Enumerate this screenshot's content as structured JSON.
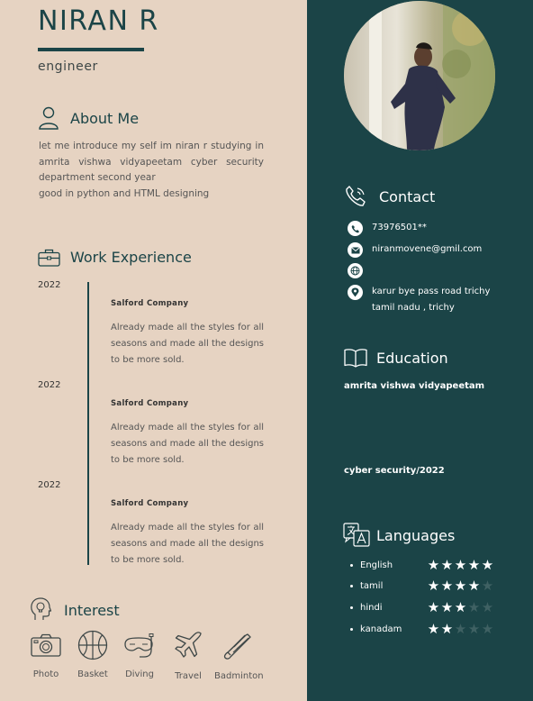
{
  "header": {
    "name": "NIRAN R",
    "role": "engineer"
  },
  "about": {
    "title": "About Me",
    "lines": [
      "let me introduce my self im niran r studying in amrita vishwa vidyapeetam cyber security department second year",
      "good in python and HTML designing"
    ]
  },
  "work": {
    "title": "Work Experience",
    "items": [
      {
        "year": "2022",
        "company": "Salford Company",
        "description": "Already made all the styles for all seasons and made all the designs to be more sold."
      },
      {
        "year": "2022",
        "company": "Salford Company",
        "description": "Already made all the styles for all seasons and made all the designs to be more sold."
      },
      {
        "year": "2022",
        "company": "Salford Company",
        "description": "Already made all the styles for all seasons and made all the designs to be more sold."
      }
    ]
  },
  "interest": {
    "title": "Interest",
    "items": [
      {
        "label": "Photo",
        "icon": "camera-icon"
      },
      {
        "label": "Basket",
        "icon": "basketball-icon"
      },
      {
        "label": "Diving",
        "icon": "diving-mask-icon"
      },
      {
        "label": "Travel",
        "icon": "airplane-icon"
      },
      {
        "label": "Badminton",
        "icon": "shuttlecock-icon"
      }
    ]
  },
  "contact": {
    "title": "Contact",
    "phone": "73976501**",
    "email": "niranmovene@gmil.com",
    "website": "",
    "address_line1": "karur bye pass road trichy",
    "address_line2": "tamil nadu , trichy"
  },
  "education": {
    "title": "Education",
    "school": "amrita vishwa vidyapeetam",
    "degree": "cyber security/2022"
  },
  "languages": {
    "title": "Languages",
    "items": [
      {
        "name": "English",
        "rating": 5
      },
      {
        "name": "tamil",
        "rating": 4
      },
      {
        "name": "hindi",
        "rating": 3
      },
      {
        "name": "kanadam",
        "rating": 2
      }
    ],
    "max_rating": 5
  },
  "colors": {
    "cream": "#e6d3c2",
    "teal": "#1b4447"
  }
}
